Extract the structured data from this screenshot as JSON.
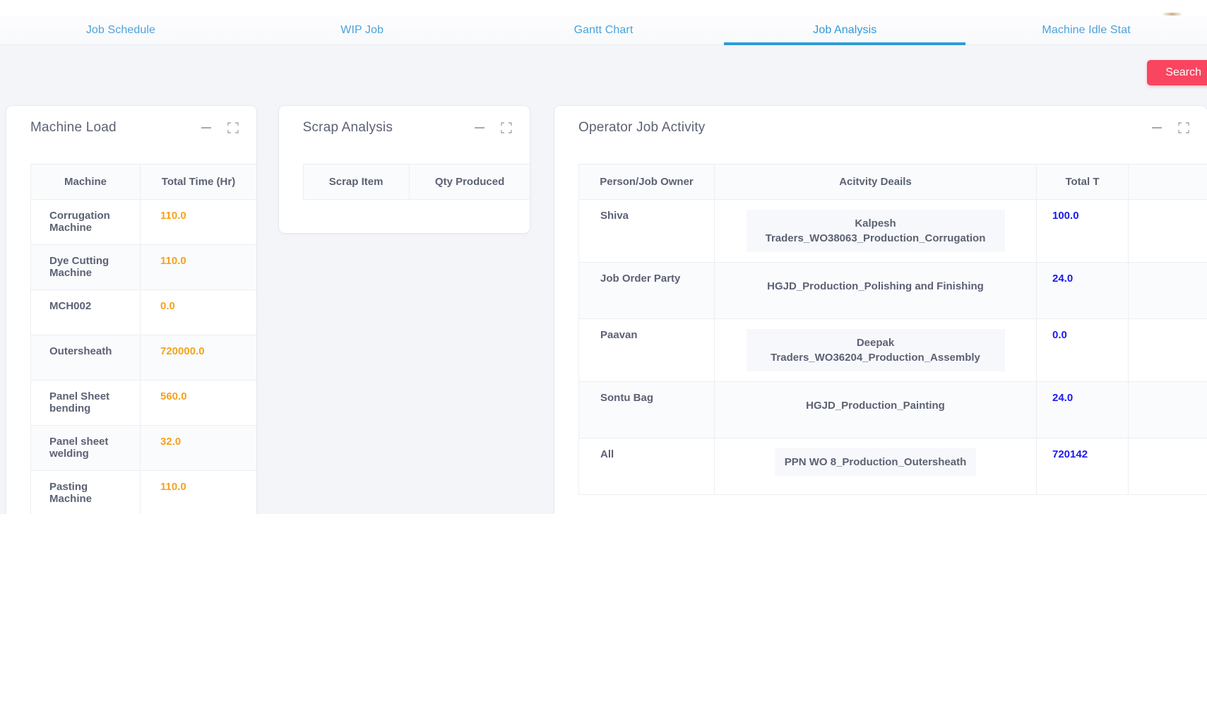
{
  "tabs": [
    {
      "label": "Job Schedule",
      "active": false
    },
    {
      "label": "WIP Job",
      "active": false
    },
    {
      "label": "Gantt Chart",
      "active": false
    },
    {
      "label": "Job Analysis",
      "active": true
    },
    {
      "label": "Machine Idle Stat",
      "active": false
    }
  ],
  "toolbar": {
    "search_label": "Search"
  },
  "colors": {
    "tab_accent": "#2e9bd6",
    "search_button": "#f9455f",
    "machine_value": "#f4a31c",
    "total_value": "#1a1aee",
    "page_background": "#f4f5f9"
  },
  "panels": {
    "machine_load": {
      "title": "Machine Load",
      "minimize_icon": "minimize-icon",
      "expand_icon": "expand-icon",
      "columns": [
        "Machine",
        "Total Time (Hr)"
      ],
      "rows": [
        {
          "machine": "Corrugation Machine",
          "total_time": "110.0"
        },
        {
          "machine": "Dye Cutting Machine",
          "total_time": "110.0"
        },
        {
          "machine": "MCH002",
          "total_time": "0.0"
        },
        {
          "machine": "Outersheath",
          "total_time": "720000.0"
        },
        {
          "machine": "Panel Sheet bending",
          "total_time": "560.0"
        },
        {
          "machine": "Panel sheet welding",
          "total_time": "32.0"
        },
        {
          "machine": "Pasting Machine",
          "total_time": "110.0"
        }
      ]
    },
    "scrap_analysis": {
      "title": "Scrap Analysis",
      "minimize_icon": "minimize-icon",
      "expand_icon": "expand-icon",
      "columns": [
        "Scrap Item",
        "Qty Produced"
      ],
      "rows": []
    },
    "operator_job_activity": {
      "title": "Operator Job Activity",
      "minimize_icon": "minimize-icon",
      "expand_icon": "expand-icon",
      "columns": [
        "Person/Job Owner",
        "Acitvity Deails",
        "Total T"
      ],
      "rows": [
        {
          "person": "Shiva",
          "activity": "Kalpesh Traders_WO38063_Production_Corrugation",
          "chip": true,
          "total": "100.0"
        },
        {
          "person": "Job Order Party",
          "activity": "HGJD_Production_Polishing and Finishing",
          "chip": false,
          "total": "24.0"
        },
        {
          "person": "Paavan",
          "activity": "Deepak Traders_WO36204_Production_Assembly",
          "chip": true,
          "total": "0.0"
        },
        {
          "person": "Sontu Bag",
          "activity": "HGJD_Production_Painting",
          "chip": false,
          "total": "24.0"
        },
        {
          "person": "All",
          "activity": "PPN WO 8_Production_Outersheath",
          "chip": true,
          "total": "720142"
        }
      ]
    }
  }
}
